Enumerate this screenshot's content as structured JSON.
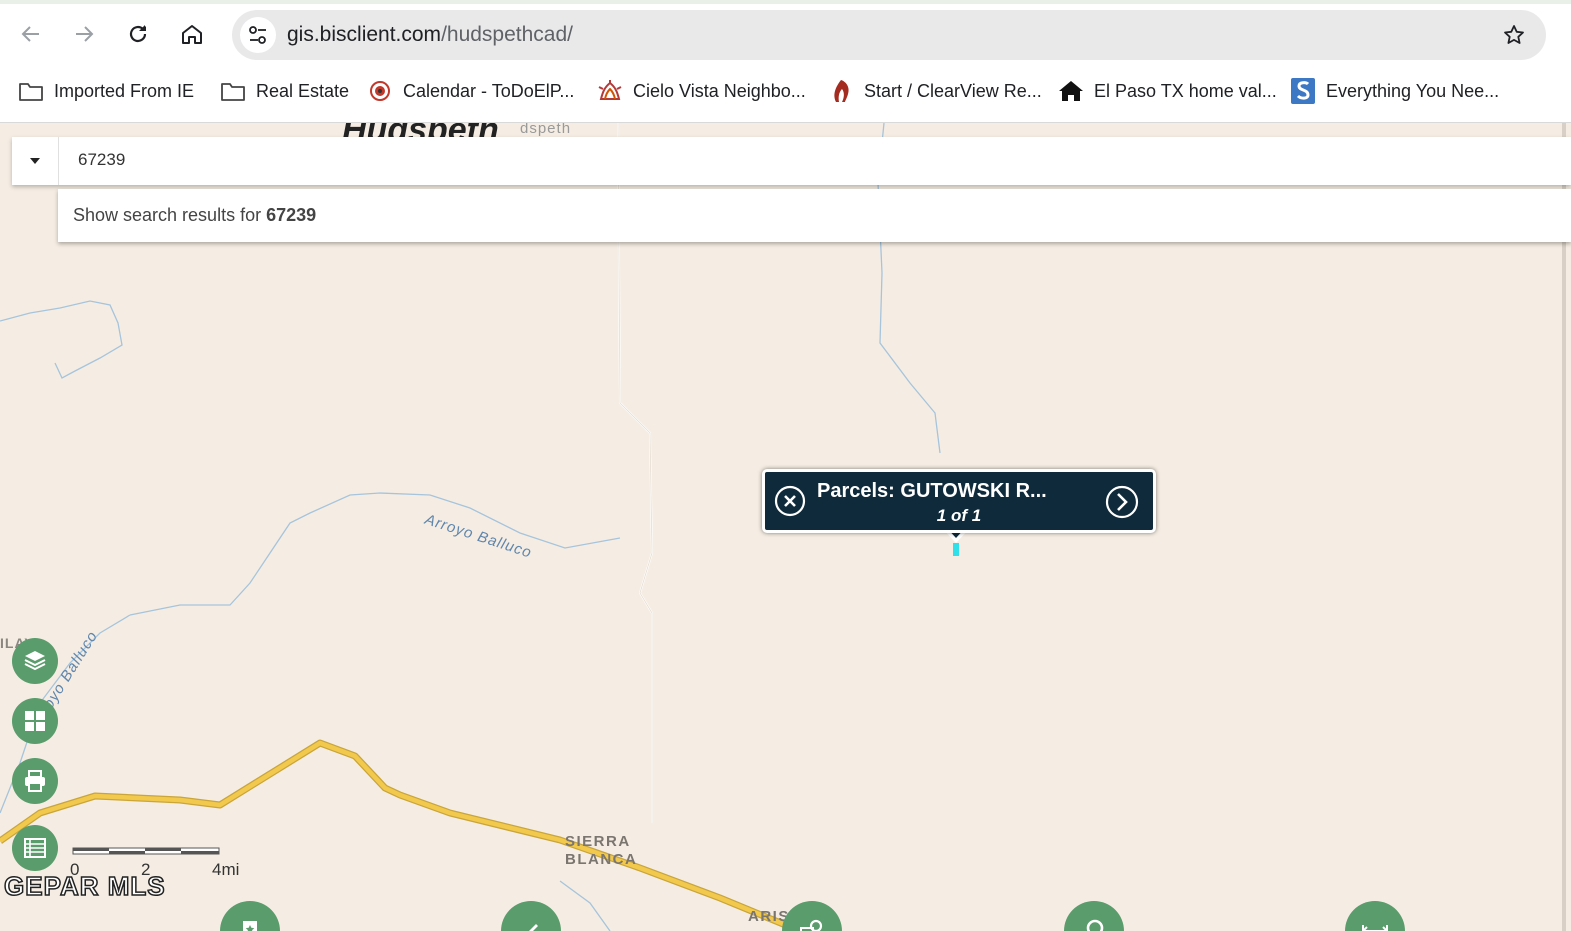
{
  "browser": {
    "url_domain": "gis.bisclient.com",
    "url_path": "/hudspethcad/",
    "bookmarks": [
      {
        "label": "Imported From IE",
        "icon": "folder-icon"
      },
      {
        "label": "Real Estate",
        "icon": "folder-icon"
      },
      {
        "label": "Calendar - ToDoElP...",
        "icon": "calendar-site-icon"
      },
      {
        "label": "Cielo Vista Neighbo...",
        "icon": "cielo-vista-icon"
      },
      {
        "label": "Start / ClearView Re...",
        "icon": "clearview-icon"
      },
      {
        "label": "El Paso TX home val...",
        "icon": "house-icon"
      },
      {
        "label": "Everything You Nee...",
        "icon": "s-site-icon"
      }
    ]
  },
  "search": {
    "value": "67239",
    "suggestion_prefix": "Show search results for ",
    "suggestion_term": "67239"
  },
  "popup": {
    "title": "Parcels: GUTOWSKI R...",
    "count": "1 of 1"
  },
  "map": {
    "county_label": "Hudspeth",
    "county_label_small": "dspeth",
    "river_label_1": "Arroyo Balluco",
    "river_label_2": "oyo Balluco",
    "edge_label": "ILAY",
    "town_line1": "SIERRA",
    "town_line2": "BLANCA",
    "town_partial": "ARIS",
    "scale_labels": [
      "0",
      "2",
      "4mi"
    ],
    "watermark": "GEPAR MLS"
  },
  "colors": {
    "map_bg": "#f5ede3",
    "tool_green": "#5a9c6b",
    "popup_bg": "#0f2a3b",
    "highway": "#f2c94c",
    "water": "#a6c4dc",
    "parcel": "#2fe0ea"
  }
}
